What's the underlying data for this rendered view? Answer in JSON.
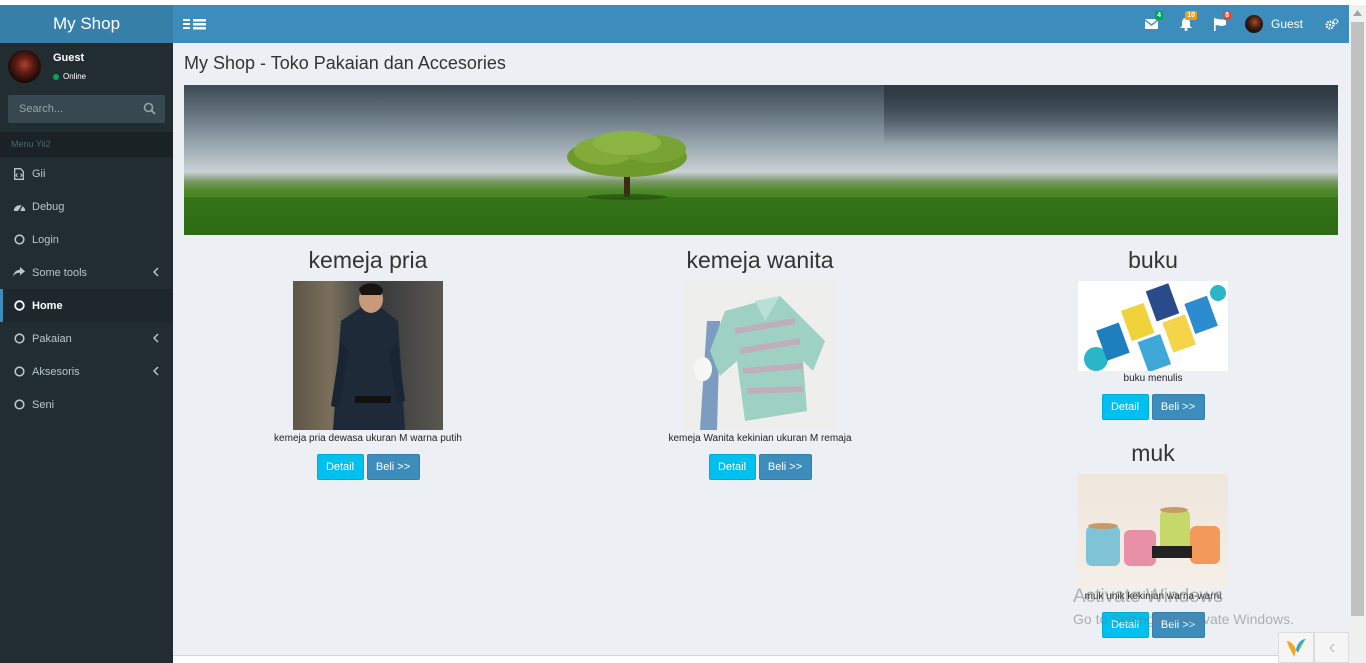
{
  "header": {
    "logo": "My Shop",
    "user_name": "Guest",
    "badges": {
      "messages": "4",
      "notifications": "10",
      "tasks": "8"
    }
  },
  "sidebar": {
    "user_name": "Guest",
    "status": "Online",
    "search_placeholder": "Search...",
    "menu_header": "Menu Yii2",
    "items": [
      {
        "label": "Gii",
        "icon": "file-code-icon"
      },
      {
        "label": "Debug",
        "icon": "dashboard-icon"
      },
      {
        "label": "Login",
        "icon": "circle-icon"
      },
      {
        "label": "Some tools",
        "icon": "share-icon"
      },
      {
        "label": "Home",
        "icon": "circle-icon",
        "active": true
      },
      {
        "label": "Pakaian",
        "icon": "circle-icon"
      },
      {
        "label": "Aksesoris",
        "icon": "circle-icon"
      },
      {
        "label": "Seni",
        "icon": "circle-icon"
      }
    ]
  },
  "page": {
    "title": "My Shop - Toko Pakaian dan Accesories"
  },
  "products": [
    {
      "name": "kemeja pria",
      "description": "kemeja pria dewasa ukuran M warna putih",
      "detail_label": "Detail",
      "buy_label": "Beli >>"
    },
    {
      "name": "kemeja wanita",
      "description": "kemeja Wanita kekinian ukuran M remaja",
      "detail_label": "Detail",
      "buy_label": "Beli >>"
    },
    {
      "name": "buku",
      "description": "buku menulis",
      "detail_label": "Detail",
      "buy_label": "Beli >>"
    },
    {
      "name": "muk",
      "description": "muk unik kekinian warna-warni",
      "detail_label": "Detail",
      "buy_label": "Beli >>"
    }
  ],
  "watermark": {
    "line1": "Activate Windows",
    "line2": "Go to Settings to activate Windows."
  },
  "colors": {
    "header": "#3c8dbc",
    "logo_bg": "#367fa9",
    "sidebar": "#222d32",
    "content_bg": "#ecf0f5",
    "btn_detail": "#00c0ef",
    "btn_buy": "#3c8dbc"
  }
}
